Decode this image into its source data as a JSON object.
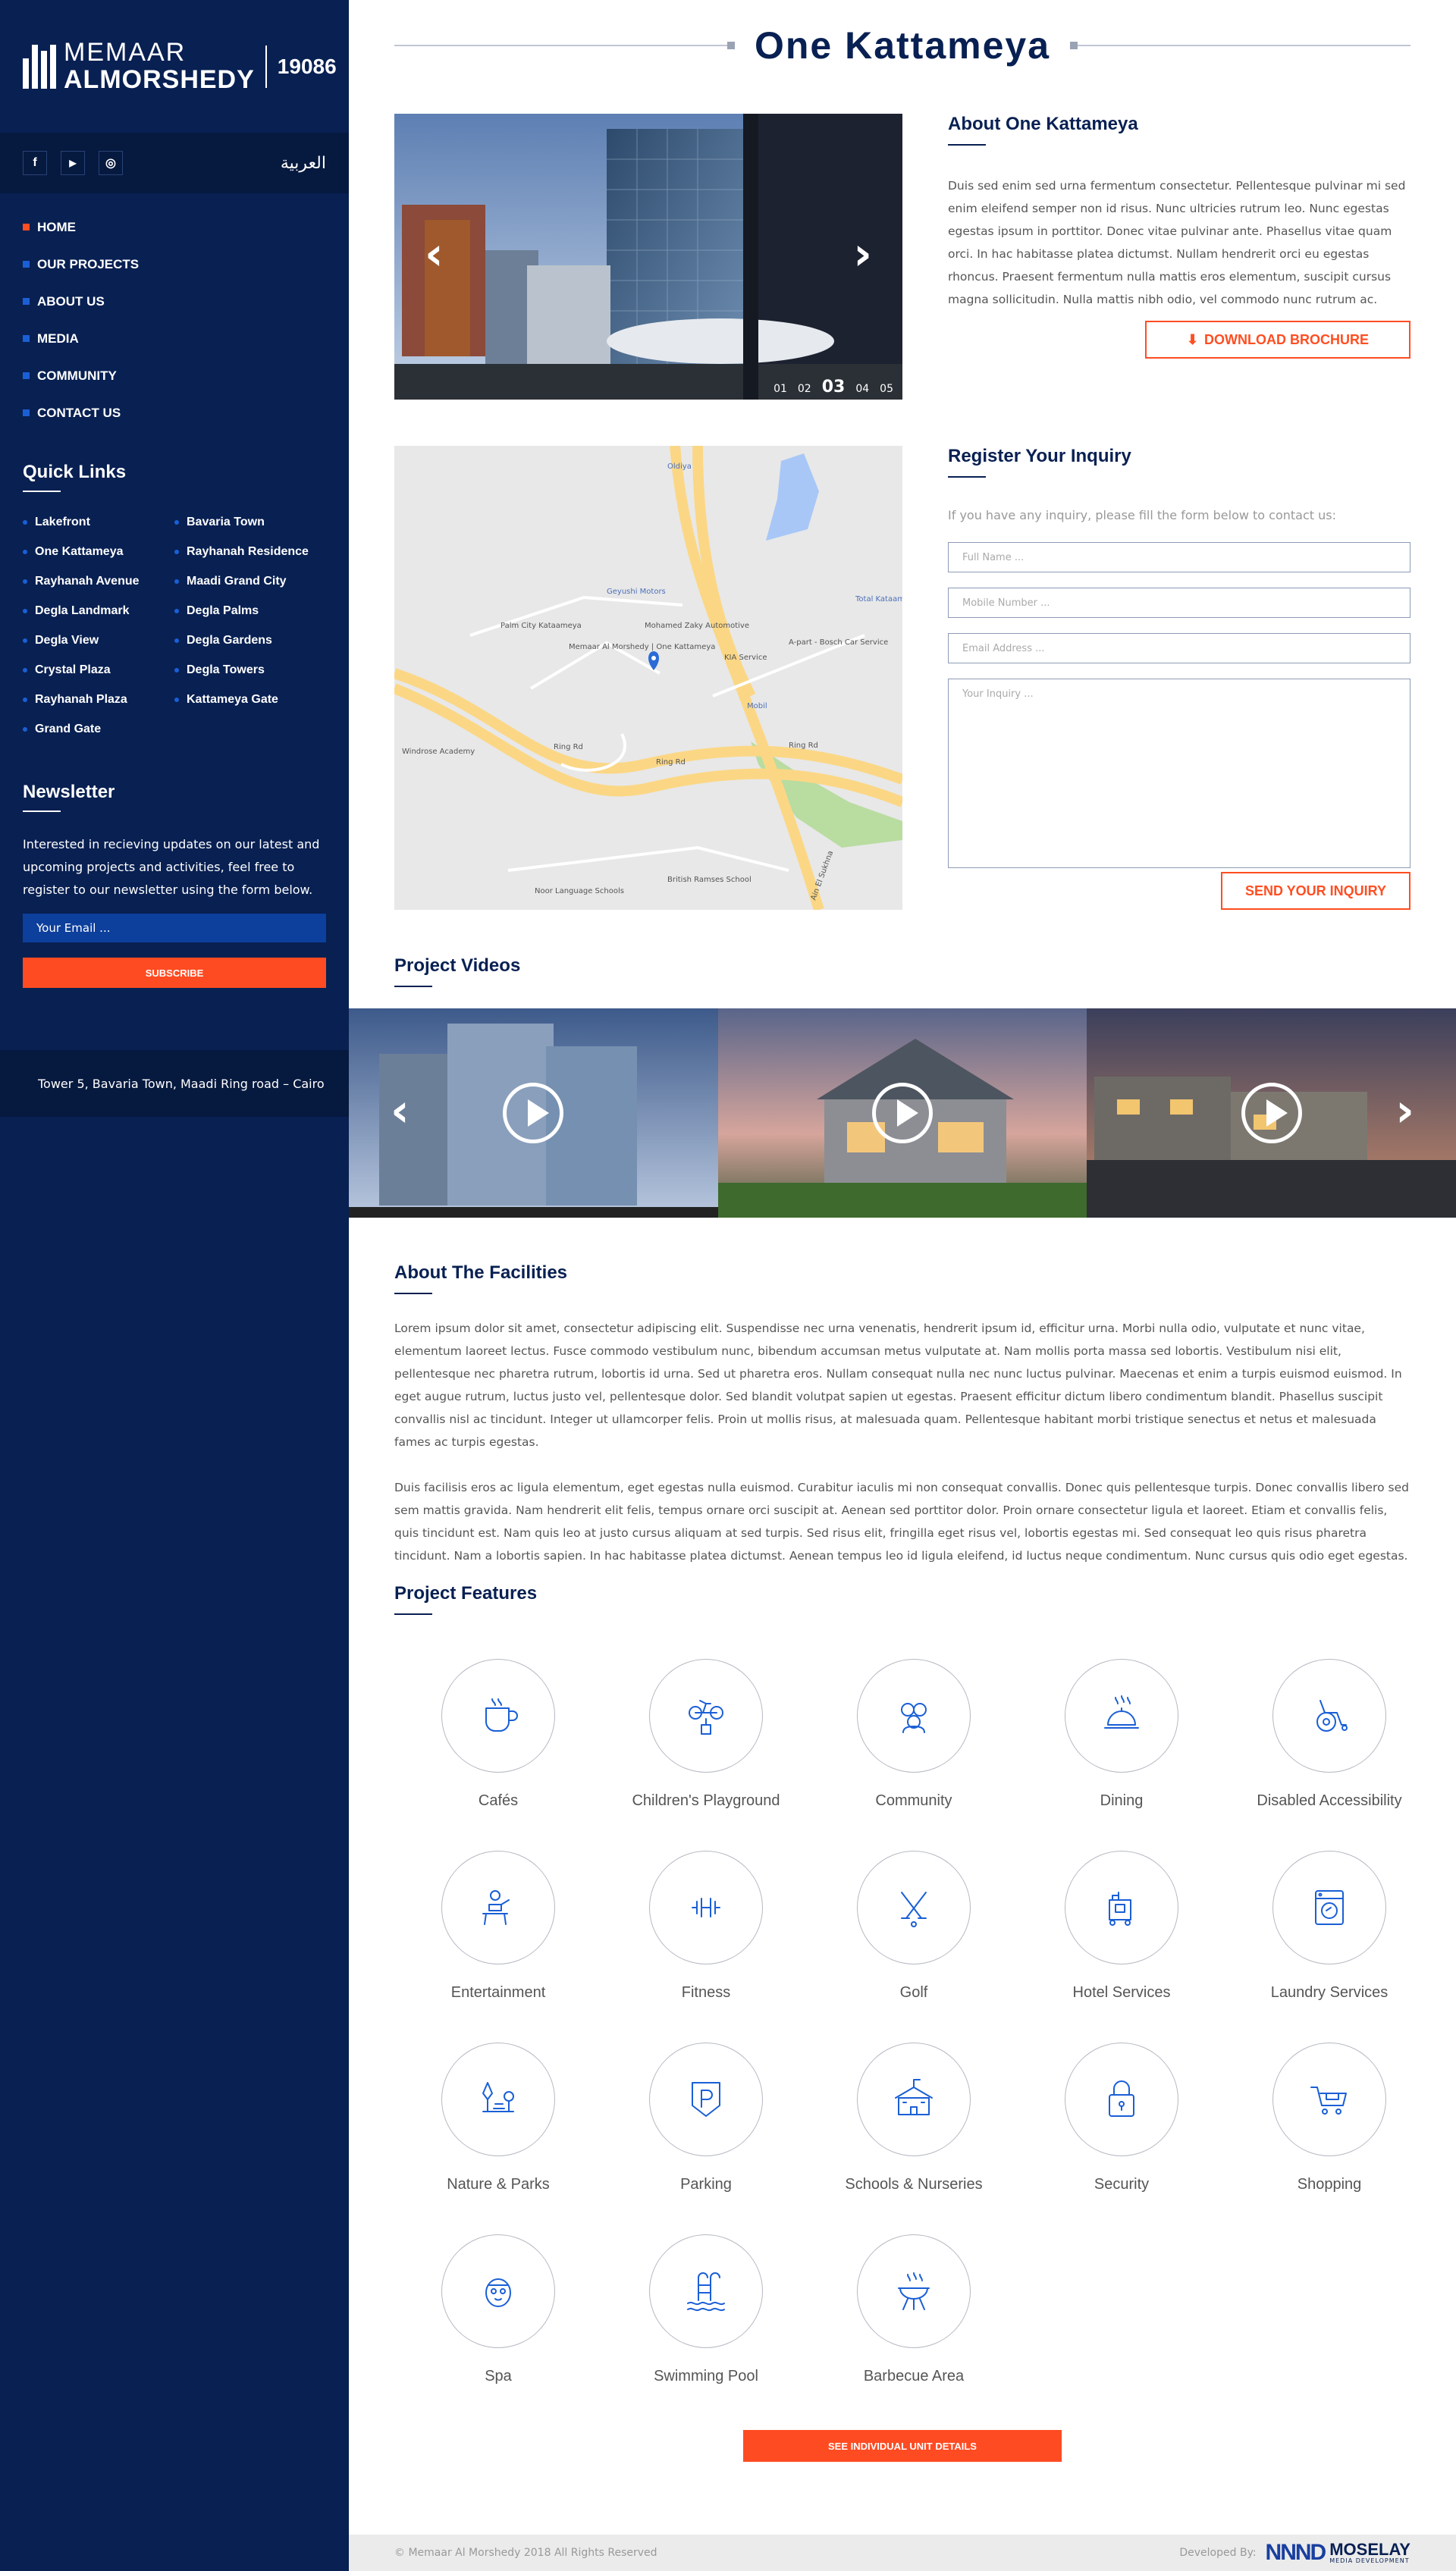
{
  "brand": {
    "line1": "MEMAAR",
    "line2": "ALMORSHEDY",
    "hotline": "19086"
  },
  "social": {
    "facebook": "f",
    "youtube": "▶",
    "instagram": "◎",
    "language": "العربية"
  },
  "nav": [
    {
      "label": "HOME",
      "active": true
    },
    {
      "label": "OUR PROJECTS"
    },
    {
      "label": "ABOUT US"
    },
    {
      "label": "MEDIA"
    },
    {
      "label": "COMMUNITY"
    },
    {
      "label": "CONTACT US"
    }
  ],
  "quick_links": {
    "title": "Quick Links",
    "items": [
      "Lakefront",
      "Bavaria Town",
      "One Kattameya",
      "Rayhanah Residence",
      "Rayhanah Avenue",
      "Maadi Grand City",
      "Degla Landmark",
      "Degla Palms",
      "Degla View",
      "Degla Gardens",
      "Crystal Plaza",
      "Degla Towers",
      "Rayhanah Plaza",
      "Kattameya Gate",
      "Grand Gate"
    ]
  },
  "newsletter": {
    "title": "Newsletter",
    "text": "Interested in recieving updates on our latest and upcoming projects and activities, feel free to register to our newsletter using the form below.",
    "placeholder": "Your Email ...",
    "button": "SUBSCRIBE"
  },
  "address": "Tower 5,  Bavaria Town, Maadi Ring road – Cairo",
  "page_title": "One Kattameya",
  "slider": {
    "pager": [
      "01",
      "02",
      "03",
      "04",
      "05"
    ],
    "current": "03"
  },
  "about": {
    "title": "About One Kattameya",
    "text": "Duis sed enim sed urna fermentum consectetur. Pellentesque pulvinar mi sed enim eleifend semper non id risus. Nunc ultricies rutrum leo. Nunc egestas egestas ipsum in porttitor. Donec vitae pulvinar ante. Phasellus vitae quam orci. In hac habitasse platea dictumst. Nullam hendrerit orci eu egestas rhoncus. Praesent fermentum nulla mattis eros elementum, suscipit cursus magna sollicitudin. Nulla mattis nibh odio, vel commodo nunc rutrum ac.",
    "download": "DOWNLOAD BROCHURE"
  },
  "map_labels": {
    "oldiya": "Oldiya",
    "geyushi": "Geyushi Motors",
    "palm_city": "Palm City Kataameya",
    "zaky": "Mohamed Zaky Automotive",
    "memaar": "Memaar Al Morshedy | One Kattameya",
    "kia": "KIA Service",
    "bosch": "A-part - Bosch Car Service",
    "total": "Total Kataameya",
    "mobil": "Mobil",
    "windrose": "Windrose Academy",
    "ring1": "Ring Rd",
    "ring2": "Ring Rd",
    "ring3": "Ring Rd",
    "british": "British Ramses School",
    "noor": "Noor Language Schools",
    "suez": "Ain El Sukhna"
  },
  "inquiry": {
    "title": "Register Your Inquiry",
    "hint": "If you have any inquiry, please fill the form below to contact us:",
    "full_name": "Full Name ...",
    "mobile": "Mobile Number ...",
    "email": "Email Address ...",
    "message": "Your Inquiry ...",
    "send": "SEND YOUR INQUIRY"
  },
  "videos_title": "Project Videos",
  "facilities": {
    "title": "About The Facilities",
    "p1": "Lorem ipsum dolor sit amet, consectetur adipiscing elit. Suspendisse nec urna venenatis, hendrerit ipsum id, efficitur urna. Morbi nulla odio, vulputate et nunc vitae, elementum laoreet lectus. Fusce commodo vestibulum nunc, bibendum accumsan metus vulputate at. Nam mollis porta massa sed lobortis. Vestibulum nisi elit, pellentesque nec pharetra rutrum, lobortis id urna. Sed ut pharetra eros. Nullam consequat nulla nec nunc luctus pulvinar. Maecenas et enim a turpis euismod euismod. In eget augue rutrum, luctus justo vel, pellentesque dolor. Sed blandit volutpat sapien ut egestas. Praesent efficitur dictum libero condimentum blandit. Phasellus suscipit convallis nisl ac tincidunt. Integer ut ullamcorper felis. Proin ut mollis risus, at malesuada quam. Pellentesque habitant morbi tristique senectus et netus et malesuada fames ac turpis egestas.",
    "p2": "Duis facilisis eros ac ligula elementum, eget egestas nulla euismod. Curabitur iaculis mi non consequat convallis. Donec quis pellentesque turpis. Donec convallis libero sed sem mattis gravida. Nam hendrerit elit felis, tempus ornare orci suscipit at. Aenean sed porttitor dolor. Proin ornare consectetur ligula et laoreet. Etiam et convallis felis, quis tincidunt est. Nam quis leo at justo cursus aliquam at sed turpis. Sed risus elit, fringilla eget risus vel, lobortis egestas mi. Sed consequat leo quis risus pharetra tincidunt. Nam a lobortis sapien. In hac habitasse platea dictumst. Aenean tempus leo id ligula eleifend, id luctus neque condimentum. Nunc cursus quis odio eget egestas."
  },
  "features": {
    "title": "Project Features",
    "items": [
      {
        "label": "Cafés",
        "icon": "cafe-icon"
      },
      {
        "label": "Children's Playground",
        "icon": "playground-icon"
      },
      {
        "label": "Community",
        "icon": "community-icon"
      },
      {
        "label": "Dining",
        "icon": "dining-icon"
      },
      {
        "label": "Disabled Accessibility",
        "icon": "wheelchair-icon"
      },
      {
        "label": "Entertainment",
        "icon": "entertainment-icon"
      },
      {
        "label": "Fitness",
        "icon": "dumbbell-icon"
      },
      {
        "label": "Golf",
        "icon": "golf-icon"
      },
      {
        "label": "Hotel Services",
        "icon": "hotel-cart-icon"
      },
      {
        "label": "Laundry Services",
        "icon": "washing-machine-icon"
      },
      {
        "label": "Nature & Parks",
        "icon": "park-icon"
      },
      {
        "label": "Parking",
        "icon": "parking-icon"
      },
      {
        "label": "Schools & Nurseries",
        "icon": "school-icon"
      },
      {
        "label": "Security",
        "icon": "lock-icon"
      },
      {
        "label": "Shopping",
        "icon": "shopping-cart-icon"
      },
      {
        "label": "Spa",
        "icon": "spa-icon"
      },
      {
        "label": "Swimming Pool",
        "icon": "pool-icon"
      },
      {
        "label": "Barbecue Area",
        "icon": "barbecue-icon"
      }
    ],
    "unit_button": "SEE INDIVIDUAL UNIT DETAILS"
  },
  "footer": {
    "copyright": "© Memaar Al Morshedy 2018 All Rights Reserved",
    "developed_by": "Developed By:",
    "dev_name": "MOSELAY",
    "dev_sub": "MEDIA DEVELOPMENT"
  },
  "colors": {
    "navy": "#082052",
    "accent": "#ff4e22",
    "blue": "#1a5fd6"
  }
}
